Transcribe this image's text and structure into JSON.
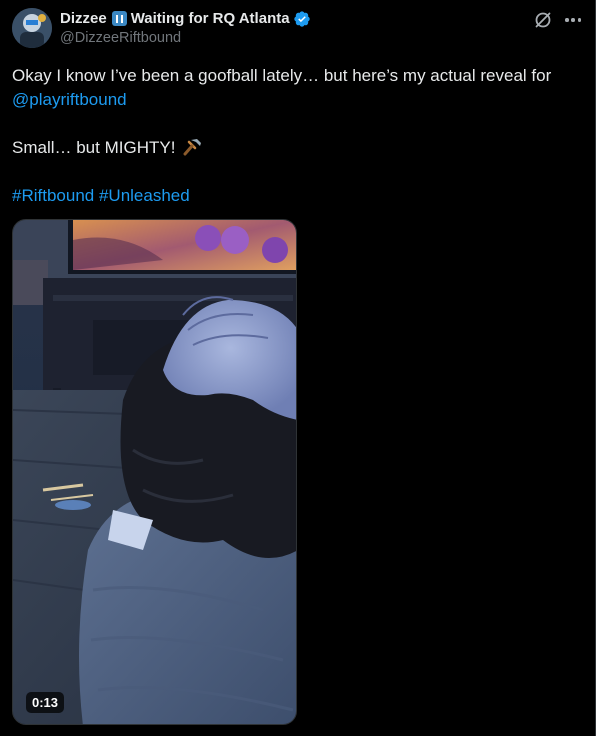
{
  "author": {
    "display_name": "Dizzee",
    "status": "Waiting for RQ Atlanta",
    "handle": "@DizzeeRiftbound",
    "verified": true,
    "status_emoji": "pause-button-icon"
  },
  "post": {
    "line1": "Okay I know I’ve been a goofball lately… but here’s my actual reveal for ",
    "mention": "@playriftbound",
    "line2": "Small… but MIGHTY!",
    "line2_emoji": "hammer-icon",
    "hashtag1": "#Riftbound",
    "hashtag2": "#Unleashed"
  },
  "media": {
    "type": "video",
    "duration": "0:13"
  },
  "colors": {
    "background": "#000000",
    "text": "#e7e9ea",
    "secondary": "#71767b",
    "link": "#1d9bf0",
    "verified": "#1d9bf0"
  }
}
